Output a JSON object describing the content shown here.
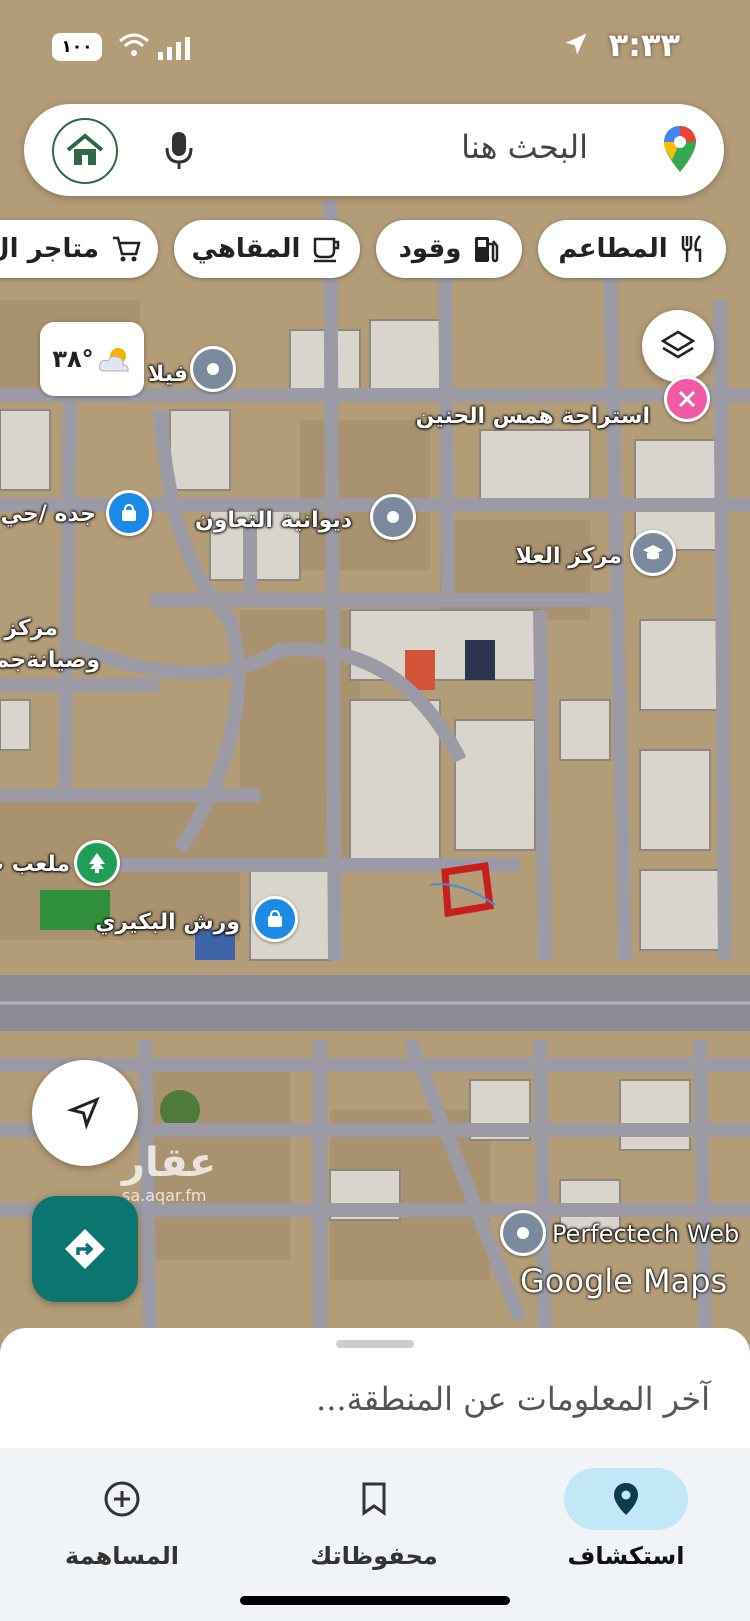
{
  "status_bar": {
    "time": "٣:٣٣",
    "battery": "١٠٠"
  },
  "search": {
    "placeholder": "البحث هنا"
  },
  "chips": [
    {
      "label": "المطاعم",
      "icon": "fork-knife-icon"
    },
    {
      "label": "وقود",
      "icon": "fuel-icon"
    },
    {
      "label": "المقاهي",
      "icon": "coffee-icon"
    },
    {
      "label": "متاجر ال",
      "icon": "cart-icon"
    }
  ],
  "weather": {
    "temp": "٣٨°"
  },
  "places": [
    {
      "name": "استراحة همس الحنين",
      "icon": "tools-icon"
    },
    {
      "name": "فيلا",
      "icon": "place-icon"
    },
    {
      "name": "جده /حي",
      "icon": "shopping-bag-icon"
    },
    {
      "name": "ديوانية التعاون",
      "icon": "place-icon"
    },
    {
      "name": "مركز العلا",
      "icon": "school-icon"
    },
    {
      "name": "مركز ا",
      "icon": "none"
    },
    {
      "name": "وصيانةجمي",
      "icon": "none"
    },
    {
      "name": "ملعب ب",
      "icon": "tree-icon"
    },
    {
      "name": "ورش البكيري",
      "icon": "shopping-bag-icon"
    },
    {
      "name": "Perfectech Web",
      "icon": "place-icon"
    }
  ],
  "watermarks": {
    "aqar_text": "عقار",
    "aqar_url": "sa.aqar.fm",
    "google": "Google Maps"
  },
  "sheet": {
    "latest": "آخر المعلومات عن المنطقة..."
  },
  "bottom_nav": [
    {
      "label": "استكشاف",
      "icon": "place-icon",
      "active": true
    },
    {
      "label": "محفوظاتك",
      "icon": "bookmark-icon",
      "active": false
    },
    {
      "label": "المساهمة",
      "icon": "add-circle-icon",
      "active": false
    }
  ],
  "colors": {
    "accent": "#0b7670",
    "active_pill": "#c2e7f6",
    "road": "#9c9aa4",
    "highlight_marker": "#c81e1e"
  }
}
